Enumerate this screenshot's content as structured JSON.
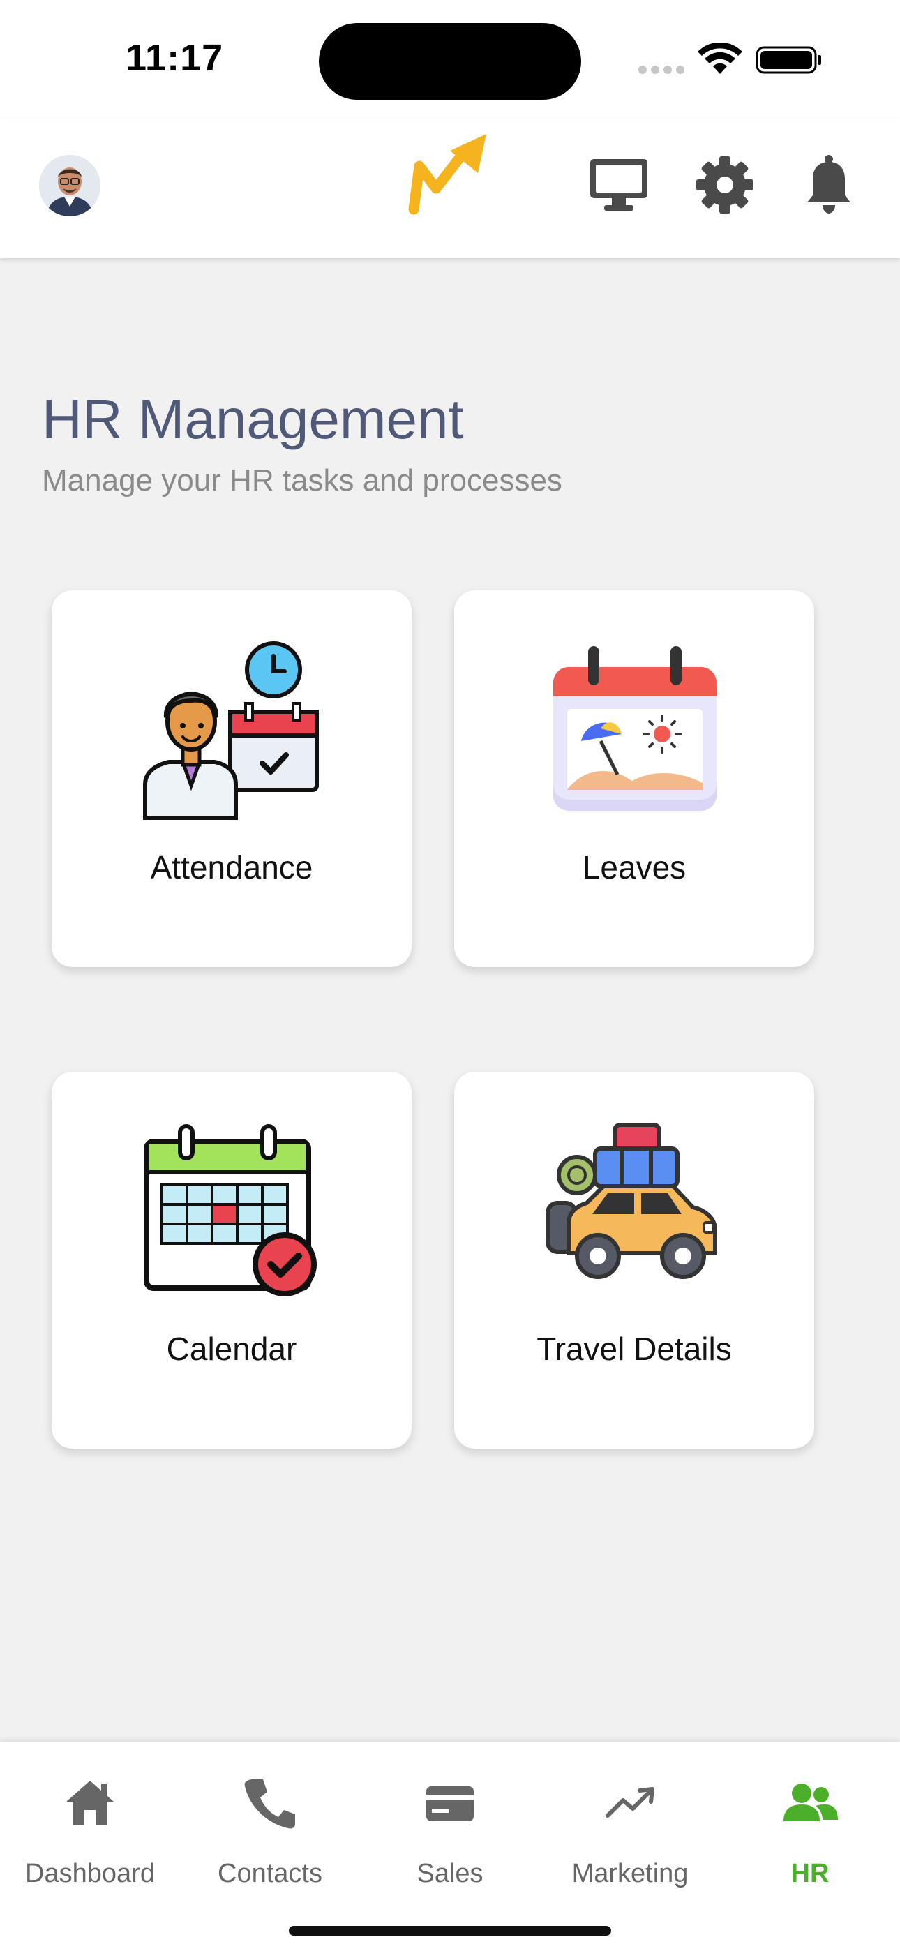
{
  "status_bar": {
    "time": "11:17"
  },
  "header": {
    "avatar_icon": "user-avatar",
    "logo_icon": "brand-logo",
    "actions": [
      "monitor-icon",
      "gear-icon",
      "bell-icon"
    ]
  },
  "page": {
    "title": "HR Management",
    "subtitle": "Manage your HR tasks and processes"
  },
  "cards": [
    {
      "label": "Attendance",
      "icon": "attendance-icon"
    },
    {
      "label": "Leaves",
      "icon": "leaves-icon"
    },
    {
      "label": "Calendar",
      "icon": "calendar-icon"
    },
    {
      "label": "Travel Details",
      "icon": "travel-icon"
    }
  ],
  "bottom_nav": {
    "items": [
      {
        "label": "Dashboard",
        "icon": "home-icon",
        "active": false
      },
      {
        "label": "Contacts",
        "icon": "phone-icon",
        "active": false
      },
      {
        "label": "Sales",
        "icon": "card-icon",
        "active": false
      },
      {
        "label": "Marketing",
        "icon": "trending-up-icon",
        "active": false
      },
      {
        "label": "HR",
        "icon": "people-icon",
        "active": true
      }
    ]
  },
  "colors": {
    "accent_active": "#4caf2a",
    "brand": "#f5b41e",
    "title": "#505a78",
    "icon_gray": "#4a4a4a"
  }
}
